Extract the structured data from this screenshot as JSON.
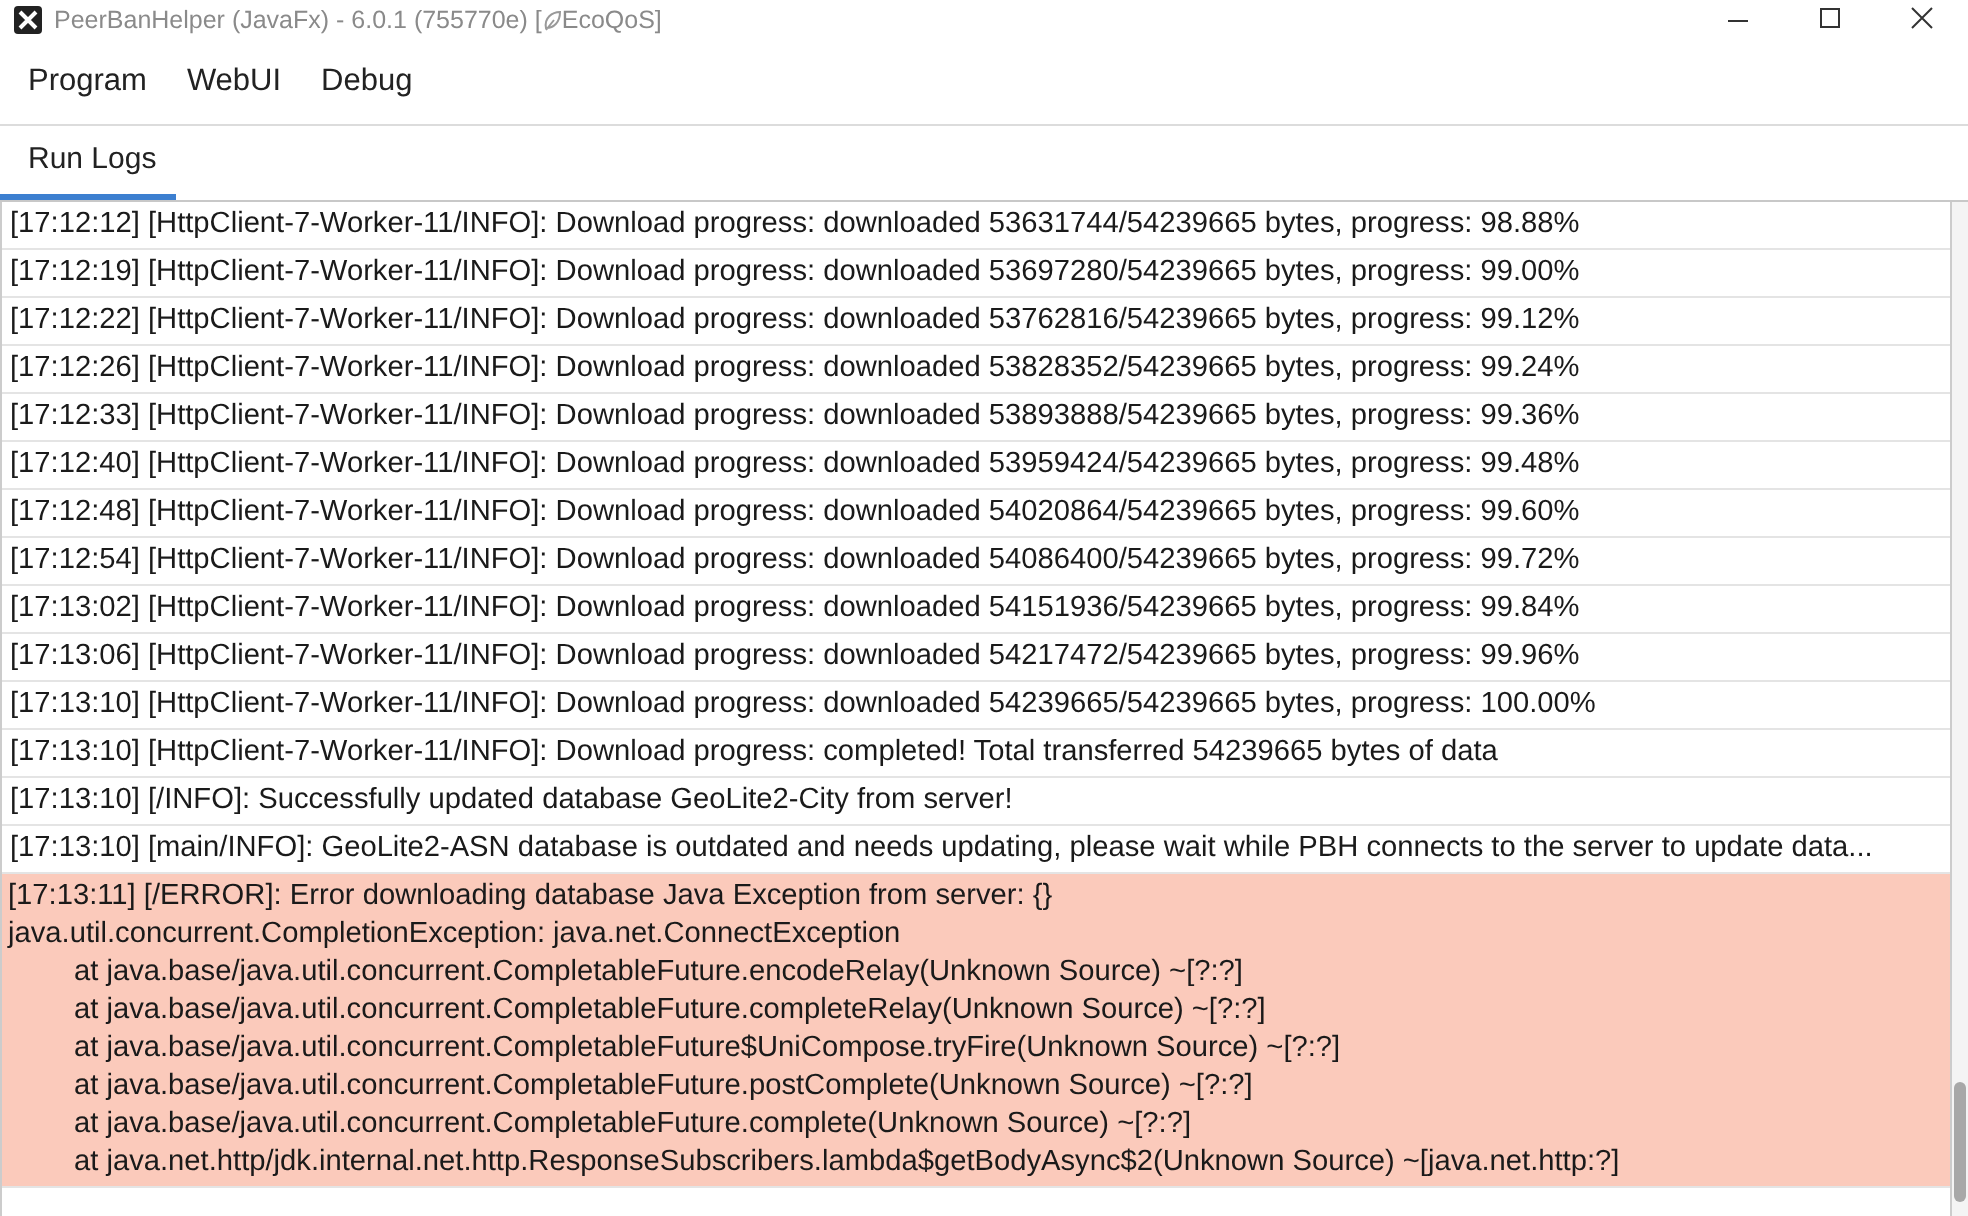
{
  "window": {
    "title": "PeerBanHelper (JavaFx) - 6.0.1 (755770e) [",
    "mode_label": "EcoQoS]"
  },
  "menu": [
    {
      "label": "Program"
    },
    {
      "label": "WebUI"
    },
    {
      "label": "Debug"
    }
  ],
  "tabs": [
    {
      "label": "Run Logs",
      "selected": true
    }
  ],
  "logs": [
    {
      "kind": "info",
      "text": "[17:12:12] [HttpClient-7-Worker-11/INFO]: Download progress: downloaded 53631744/54239665 bytes, progress: 98.88%"
    },
    {
      "kind": "info",
      "text": "[17:12:19] [HttpClient-7-Worker-11/INFO]: Download progress: downloaded 53697280/54239665 bytes, progress: 99.00%"
    },
    {
      "kind": "info",
      "text": "[17:12:22] [HttpClient-7-Worker-11/INFO]: Download progress: downloaded 53762816/54239665 bytes, progress: 99.12%"
    },
    {
      "kind": "info",
      "text": "[17:12:26] [HttpClient-7-Worker-11/INFO]: Download progress: downloaded 53828352/54239665 bytes, progress: 99.24%"
    },
    {
      "kind": "info",
      "text": "[17:12:33] [HttpClient-7-Worker-11/INFO]: Download progress: downloaded 53893888/54239665 bytes, progress: 99.36%"
    },
    {
      "kind": "info",
      "text": "[17:12:40] [HttpClient-7-Worker-11/INFO]: Download progress: downloaded 53959424/54239665 bytes, progress: 99.48%"
    },
    {
      "kind": "info",
      "text": "[17:12:48] [HttpClient-7-Worker-11/INFO]: Download progress: downloaded 54020864/54239665 bytes, progress: 99.60%"
    },
    {
      "kind": "info",
      "text": "[17:12:54] [HttpClient-7-Worker-11/INFO]: Download progress: downloaded 54086400/54239665 bytes, progress: 99.72%"
    },
    {
      "kind": "info",
      "text": "[17:13:02] [HttpClient-7-Worker-11/INFO]: Download progress: downloaded 54151936/54239665 bytes, progress: 99.84%"
    },
    {
      "kind": "info",
      "text": "[17:13:06] [HttpClient-7-Worker-11/INFO]: Download progress: downloaded 54217472/54239665 bytes, progress: 99.96%"
    },
    {
      "kind": "info",
      "text": "[17:13:10] [HttpClient-7-Worker-11/INFO]: Download progress: downloaded 54239665/54239665 bytes, progress: 100.00%"
    },
    {
      "kind": "info",
      "text": "[17:13:10] [HttpClient-7-Worker-11/INFO]: Download progress: completed! Total transferred 54239665 bytes of data"
    },
    {
      "kind": "info",
      "text": "[17:13:10] [/INFO]: Successfully updated database GeoLite2-City from server!"
    },
    {
      "kind": "info",
      "text": "[17:13:10] [main/INFO]: GeoLite2-ASN database is outdated and needs updating, please wait while PBH connects to the server to update data..."
    },
    {
      "kind": "error",
      "text": "[17:13:11] [/ERROR]: Error downloading database Java Exception from server: {}",
      "lines": [
        "java.util.concurrent.CompletionException: java.net.ConnectException"
      ],
      "trace": [
        "at java.base/java.util.concurrent.CompletableFuture.encodeRelay(Unknown Source) ~[?:?]",
        "at java.base/java.util.concurrent.CompletableFuture.completeRelay(Unknown Source) ~[?:?]",
        "at java.base/java.util.concurrent.CompletableFuture$UniCompose.tryFire(Unknown Source) ~[?:?]",
        "at java.base/java.util.concurrent.CompletableFuture.postComplete(Unknown Source) ~[?:?]",
        "at java.base/java.util.concurrent.CompletableFuture.complete(Unknown Source) ~[?:?]",
        "at java.net.http/jdk.internal.net.http.ResponseSubscribers.lambda$getBodyAsync$2(Unknown Source) ~[java.net.http:?]"
      ]
    }
  ]
}
